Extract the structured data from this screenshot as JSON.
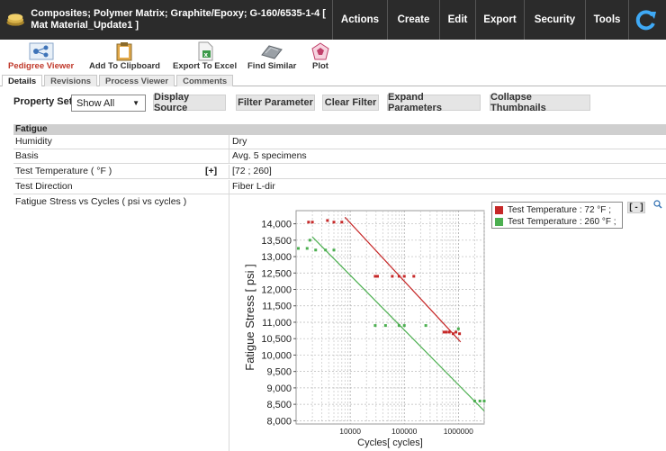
{
  "header": {
    "title": "Composites; Polymer Matrix; Graphite/Epoxy; G-160/6535-1-4 [ Mat Material_Update1 ]",
    "menus": [
      "Actions",
      "Create",
      "Edit",
      "Export",
      "Security",
      "Tools"
    ]
  },
  "toolbar": {
    "items": [
      "Pedigree Viewer",
      "Add To Clipboard",
      "Export To Excel",
      "Find Similar",
      "Plot"
    ]
  },
  "tabs": [
    "Details",
    "Revisions",
    "Process Viewer",
    "Comments"
  ],
  "filters": {
    "property_set_label": "Property Set",
    "property_set_value": "Show All",
    "buttons": [
      "Display Source",
      "Filter Parameter",
      "Clear Filter",
      "Expand Parameters",
      "Collapse Thumbnails"
    ]
  },
  "properties": {
    "section": "Fatigue",
    "rows": [
      {
        "key": "Humidity",
        "value": "Dry"
      },
      {
        "key": "Basis",
        "value": "Avg. 5 specimens"
      },
      {
        "key": "Test Temperature ( °F )",
        "value": "[72 ; 260]",
        "expand": "[+]"
      },
      {
        "key": "Test Direction",
        "value": "Fiber L-dir"
      }
    ],
    "graph_row_key": "Fatigue Stress vs Cycles ( psi vs cycles )"
  },
  "legend_collapse": "[ - ]",
  "colors": {
    "series_72": "#c62828",
    "series_260": "#4caf50",
    "accent": "#c0392b"
  },
  "chart_data": {
    "type": "scatter",
    "xlabel": "Cycles[ cycles]",
    "ylabel": "Fatigue Stress [ psi ]",
    "xscale": "log",
    "xlim": [
      1000,
      3000000
    ],
    "ylim": [
      7900,
      14400
    ],
    "yticks": [
      8000,
      8500,
      9000,
      9500,
      10000,
      10500,
      11000,
      11500,
      12000,
      12500,
      13000,
      13500,
      14000
    ],
    "ytick_labels": [
      "8,000",
      "8,500",
      "9,000",
      "9,500",
      "10,000",
      "10,500",
      "11,000",
      "11,500",
      "12,000",
      "12,500",
      "13,000",
      "13,500",
      "14,000"
    ],
    "xticks": [
      10000,
      100000,
      1000000
    ],
    "xtick_labels": [
      "10000",
      "100000",
      "1000000"
    ],
    "grid": true,
    "legend_position": "top-right",
    "series": [
      {
        "name": "Test Temperature : 72 °F ;",
        "points": [
          [
            1700,
            14050
          ],
          [
            2000,
            14050
          ],
          [
            3800,
            14100
          ],
          [
            5000,
            14050
          ],
          [
            7000,
            14050
          ],
          [
            29000,
            12400
          ],
          [
            32000,
            12400
          ],
          [
            60000,
            12400
          ],
          [
            80000,
            12400
          ],
          [
            100000,
            12400
          ],
          [
            150000,
            12400
          ],
          [
            540000,
            10700
          ],
          [
            600000,
            10700
          ],
          [
            680000,
            10700
          ],
          [
            800000,
            10650
          ],
          [
            900000,
            10700
          ],
          [
            1050000,
            10650
          ]
        ],
        "trend": [
          [
            8000,
            14200
          ],
          [
            1100000,
            10400
          ]
        ]
      },
      {
        "name": "Test Temperature : 260 °F ;",
        "points": [
          [
            1100,
            13250
          ],
          [
            1600,
            13250
          ],
          [
            1800,
            13500
          ],
          [
            2300,
            13200
          ],
          [
            3500,
            13200
          ],
          [
            5000,
            13200
          ],
          [
            29000,
            10900
          ],
          [
            45000,
            10900
          ],
          [
            80000,
            10900
          ],
          [
            100000,
            10900
          ],
          [
            250000,
            10900
          ],
          [
            1000000,
            10800
          ],
          [
            2000000,
            8600
          ],
          [
            2500000,
            8600
          ],
          [
            3000000,
            8600
          ]
        ],
        "trend": [
          [
            2000,
            13600
          ],
          [
            3000000,
            8300
          ]
        ]
      }
    ]
  }
}
